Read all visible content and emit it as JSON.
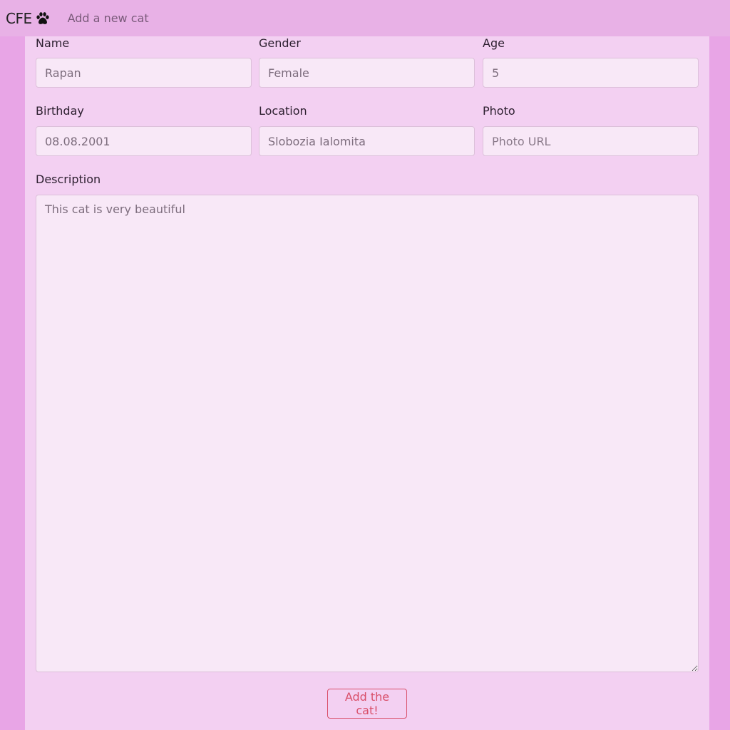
{
  "navbar": {
    "brand": "CFE",
    "brand_icon": "paw-icon",
    "link_add_cat": "Add a new cat"
  },
  "form": {
    "name": {
      "label": "Name",
      "value": "Rapan"
    },
    "gender": {
      "label": "Gender",
      "value": "Female"
    },
    "age": {
      "label": "Age",
      "value": "5"
    },
    "birthday": {
      "label": "Birthday",
      "value": "08.08.2001"
    },
    "location": {
      "label": "Location",
      "value": "Slobozia Ialomita"
    },
    "photo": {
      "label": "Photo",
      "value": "",
      "placeholder": "Photo URL"
    },
    "description": {
      "label": "Description",
      "value": "This cat is very beautiful"
    },
    "submit_label": "Add the cat!"
  },
  "colors": {
    "page_bg": "#e8a5e6",
    "navbar_bg": "#e8b1e6",
    "panel_bg": "#f3d0f2",
    "input_bg": "#f8e8f7",
    "button_accent": "#d9506a"
  }
}
